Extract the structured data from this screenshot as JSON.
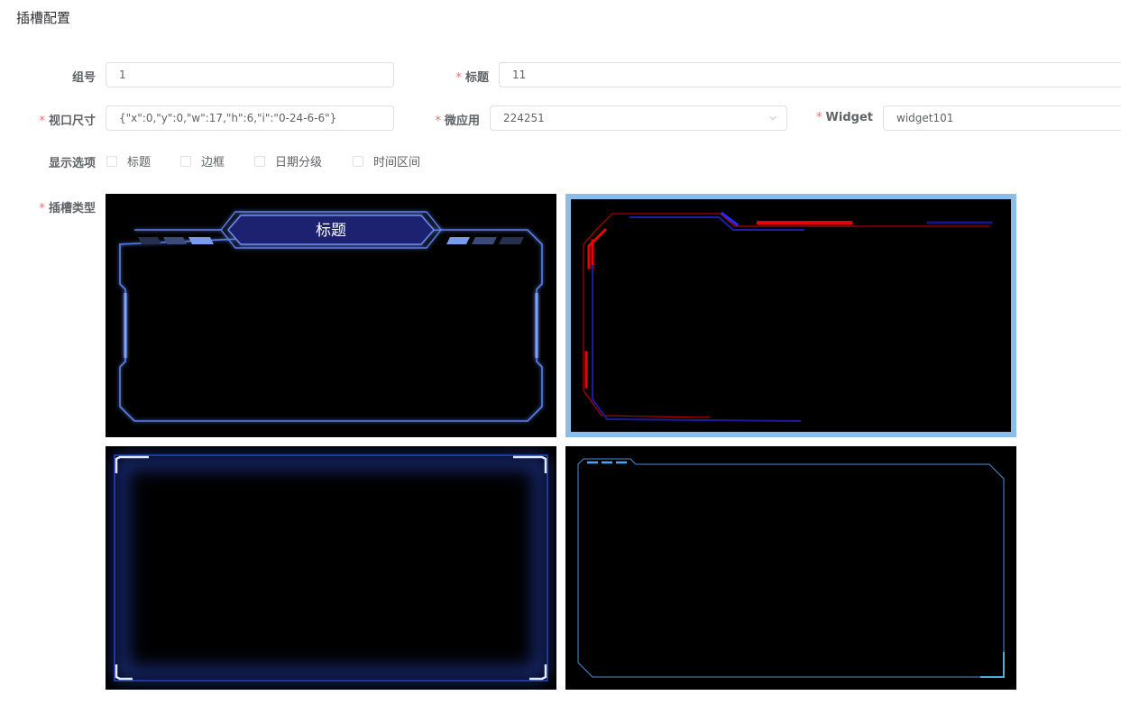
{
  "page": {
    "title": "插槽配置"
  },
  "form": {
    "group": {
      "label": "组号",
      "value": "1"
    },
    "title_field": {
      "label": "标题",
      "value": "11",
      "required": true
    },
    "viewport": {
      "label": "视口尺寸",
      "value": "{\"x\":0,\"y\":0,\"w\":17,\"h\":6,\"i\":\"0-24-6-6\"}",
      "required": true
    },
    "micro_app": {
      "label": "微应用",
      "value": "224251",
      "required": true
    },
    "widget": {
      "label": "Widget",
      "value": "widget101",
      "required": true
    },
    "display_options": {
      "label": "显示选项",
      "options": [
        {
          "label": "标题",
          "checked": false
        },
        {
          "label": "边框",
          "checked": false
        },
        {
          "label": "日期分级",
          "checked": false
        },
        {
          "label": "时间区间",
          "checked": false
        }
      ]
    },
    "slot_type": {
      "label": "插槽类型",
      "required": true,
      "selected_index": 1,
      "preview_title": "标题",
      "options": [
        {
          "name": "blue-tech-frame-with-title"
        },
        {
          "name": "red-circuit-frame"
        },
        {
          "name": "blue-glow-frame"
        },
        {
          "name": "thin-cyan-frame"
        }
      ]
    }
  },
  "colors": {
    "required_mark": "#f56c6c",
    "selected_border": "#8cbde8",
    "frame_blue": "#5a7fe8",
    "frame_red": "#e00000",
    "frame_cyan": "#4a9fd0"
  }
}
